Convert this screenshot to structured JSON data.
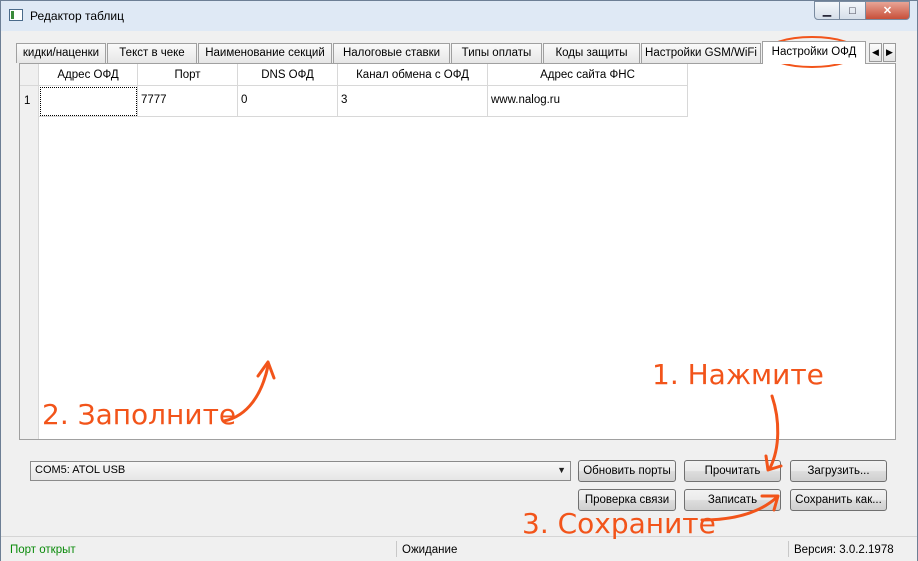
{
  "window": {
    "title": "Редактор таблиц",
    "min_glyph": "▁",
    "max_glyph": "□",
    "close_glyph": "✕"
  },
  "tabs": [
    {
      "label": "кидки/наценки"
    },
    {
      "label": "Текст в чеке"
    },
    {
      "label": "Наименование секций"
    },
    {
      "label": "Налоговые ставки"
    },
    {
      "label": "Типы оплаты"
    },
    {
      "label": "Коды защиты"
    },
    {
      "label": "Настройки GSM/WiFi"
    },
    {
      "label": "Настройки ОФД",
      "active": true
    }
  ],
  "tab_scroll": {
    "left": "◀",
    "right": "▶"
  },
  "table": {
    "columns": [
      "Адрес ОФД",
      "Порт",
      "DNS ОФД",
      "Канал обмена с ОФД",
      "Адрес сайта ФНС"
    ],
    "rows": [
      {
        "num": "1",
        "cells": [
          "",
          "7777",
          "0",
          "3",
          "www.nalog.ru"
        ]
      }
    ]
  },
  "port_select": {
    "value": "COM5: ATOL USB",
    "arrow": "▼"
  },
  "buttons": {
    "refresh_ports": "Обновить порты",
    "read": "Прочитать",
    "load": "Загрузить...",
    "check_connection": "Проверка связи",
    "write": "Записать",
    "save_as": "Сохранить как..."
  },
  "status": {
    "left": "Порт открыт",
    "middle": "Ожидание",
    "right": "Версия: 3.0.2.1978"
  },
  "annotations": {
    "step1": "1. Нажмите",
    "step2": "2. Заполните",
    "step3": "3. Сохраните",
    "color": "#f2541a"
  }
}
